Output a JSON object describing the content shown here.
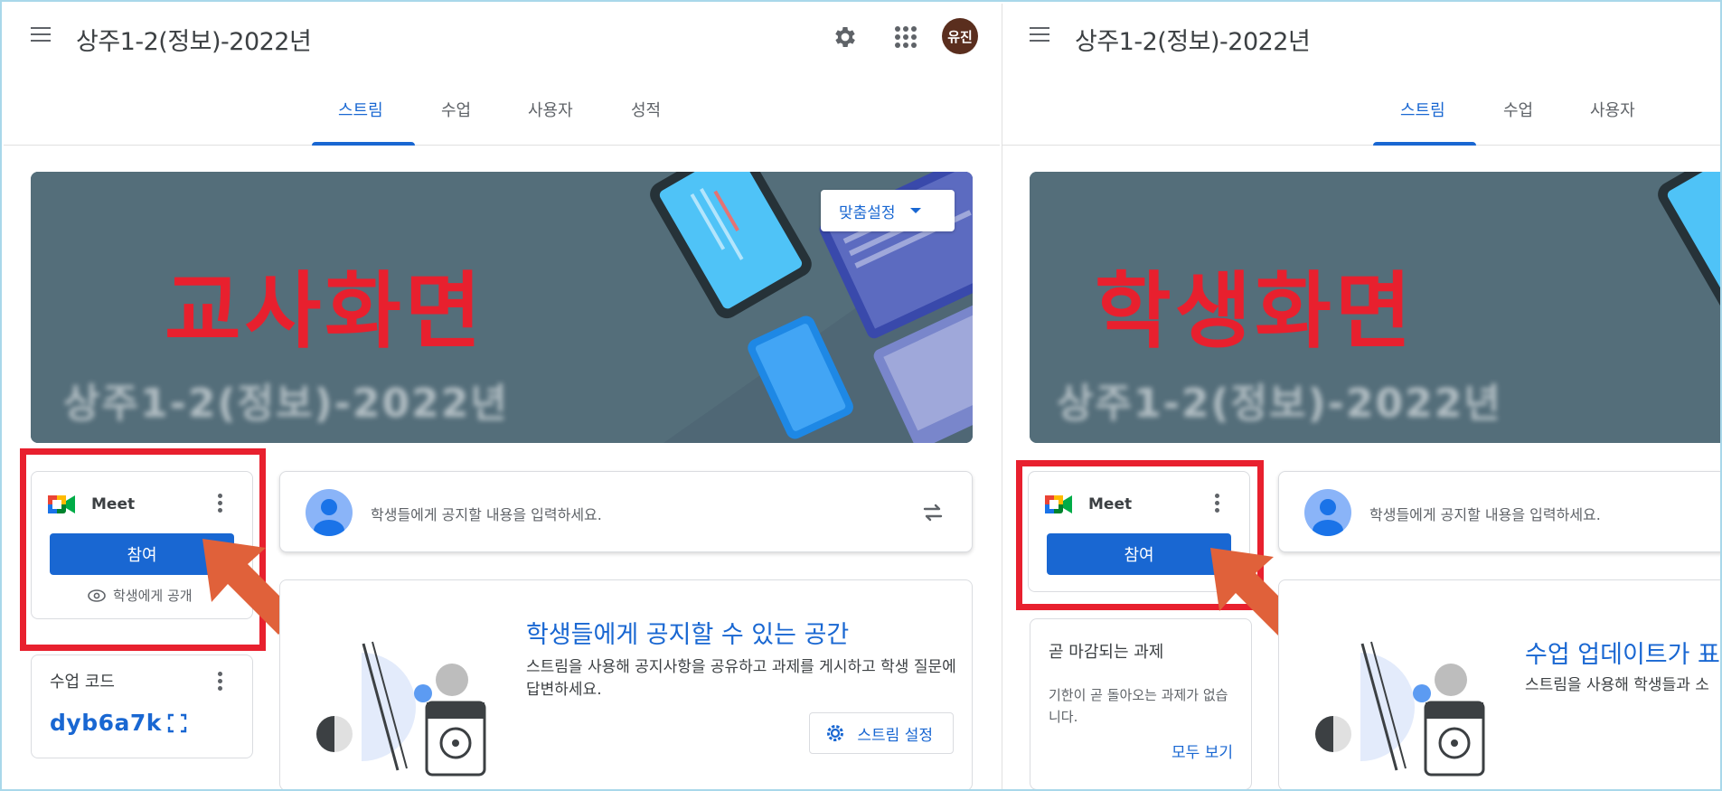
{
  "class_title": "상주1-2(정보)-2022년",
  "avatar_text": "유진",
  "tabs_left": [
    "스트림",
    "수업",
    "사용자",
    "성적"
  ],
  "tabs_right": [
    "스트림",
    "수업",
    "사용자"
  ],
  "banner_left_label": "교사화면",
  "banner_right_label": "학생화면",
  "banner_sub": "상주1-2(정보)-2022년",
  "customize_label": "맞춤설정",
  "meet_label": "Meet",
  "join_label": "참여",
  "visible_to_students": "학생에게 공개",
  "class_code_label": "수업 코드",
  "class_code": "dyb6a7k",
  "announce_placeholder": "학생들에게 공지할 내용을 입력하세요.",
  "empty_title_left": "학생들에게 공지할 수 있는 공간",
  "empty_desc_left": "스트림을 사용해 공지사항을 공유하고 과제를 게시하고 학생 질문에 답변하세요.",
  "stream_settings_label": "스트림 설정",
  "empty_title_right": "수업 업데이트가 표",
  "empty_desc_right": "스트림을 사용해 학생들과 소",
  "due_title": "곧 마감되는 과제",
  "due_desc": "기한이 곧 돌아오는 과제가 없습니다.",
  "view_all": "모두 보기",
  "colors": {
    "accent": "#1967d2",
    "highlight": "#e8202e",
    "arrow": "#e0613a",
    "banner_bg": "#546e7a",
    "avatar_bg": "#5a2e1e"
  }
}
